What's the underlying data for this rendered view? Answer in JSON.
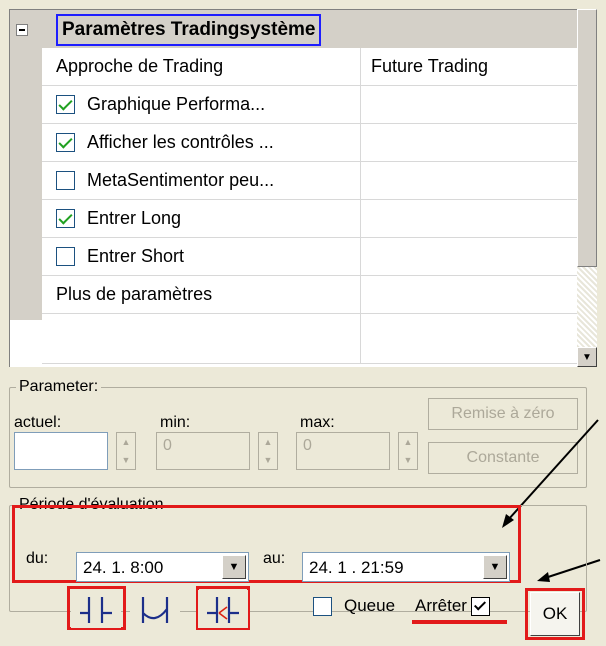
{
  "grid": {
    "section_title": "Paramètres Tradingsystème",
    "rows": [
      {
        "label": "Approche de Trading",
        "value": "Future Trading",
        "checkbox": null
      },
      {
        "label": "Graphique Performa...",
        "value": "",
        "checkbox": true
      },
      {
        "label": "Afficher les contrôles ...",
        "value": "",
        "checkbox": true
      },
      {
        "label": "MetaSentimentor peu...",
        "value": "",
        "checkbox": false
      },
      {
        "label": "Entrer Long",
        "value": "",
        "checkbox": true
      },
      {
        "label": "Entrer Short",
        "value": "",
        "checkbox": false
      },
      {
        "label": "Plus de paramètres",
        "value": "",
        "checkbox": null
      }
    ]
  },
  "parameter": {
    "legend": "Parameter:",
    "actuel_label": "actuel:",
    "min_label": "min:",
    "max_label": "max:",
    "actuel_value": "",
    "min_value": "0",
    "max_value": "0",
    "reset_button": "Remise à zéro",
    "constant_button": "Constante"
  },
  "period": {
    "legend": "Période d'évaluation",
    "from_label": "du:",
    "from_value": "24. 1.   8:00",
    "to_label": "au:",
    "to_value": "24. 1 . 21:59"
  },
  "bottom": {
    "queue_label": "Queue",
    "queue_checked": false,
    "stop_label": "Arrêter",
    "stop_checked": true,
    "ok_label": "OK"
  },
  "colors": {
    "highlight_red": "#e21a1a",
    "highlight_blue": "#1e1eff",
    "check_green": "#21a121"
  }
}
